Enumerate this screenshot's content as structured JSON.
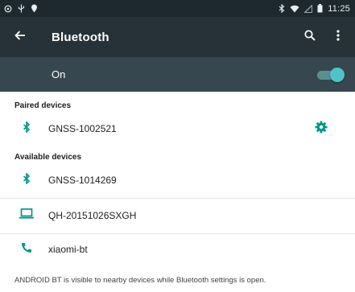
{
  "status_bar": {
    "time": "11:25",
    "left_icons": [
      "sync-icon",
      "usb-icon",
      "location-icon"
    ],
    "right_icons": [
      "bluetooth-icon",
      "wifi-icon",
      "signal-icon",
      "battery-icon"
    ]
  },
  "app_bar": {
    "title": "Bluetooth",
    "back_icon": "arrow-left-icon",
    "search_icon": "search-icon",
    "menu_icon": "more-vert-icon"
  },
  "bluetooth_toggle": {
    "label": "On",
    "checked": true
  },
  "paired": {
    "header": "Paired devices",
    "devices": [
      {
        "name": "GNSS-1002521",
        "icon": "bluetooth-icon"
      }
    ]
  },
  "available": {
    "header": "Available devices",
    "devices": [
      {
        "name": "GNSS-1014269",
        "icon": "bluetooth-icon"
      },
      {
        "name": "QH-20151026SXGH",
        "icon": "laptop-icon"
      },
      {
        "name": "xiaomi-bt",
        "icon": "phone-icon"
      }
    ]
  },
  "footer_note": "ANDROID BT is visible to nearby devices while Bluetooth settings is open.",
  "colors": {
    "status_bar": "#1d292f",
    "app_bar": "#263238",
    "toggle_row": "#37474f",
    "accent": "#009688",
    "switch_thumb": "#4fc3c8"
  }
}
